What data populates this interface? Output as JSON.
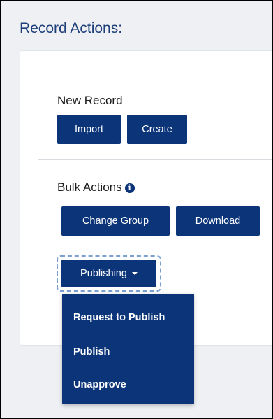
{
  "section_title": "Record Actions:",
  "new_record": {
    "label": "New Record",
    "import_label": "Import",
    "create_label": "Create"
  },
  "bulk_actions": {
    "label": "Bulk Actions",
    "info_icon": "info-circle-icon",
    "change_group_label": "Change Group",
    "download_label": "Download"
  },
  "publishing": {
    "label": "Publishing",
    "caret_icon": "caret-down-icon",
    "menu_items": [
      {
        "label": "Request to Publish"
      },
      {
        "label": "Publish"
      },
      {
        "label": "Unapprove"
      }
    ]
  },
  "colors": {
    "primary": "#0b3479",
    "title": "#1e3f7a",
    "background": "#eef0f4",
    "focus_outline": "#7a9fd0"
  }
}
